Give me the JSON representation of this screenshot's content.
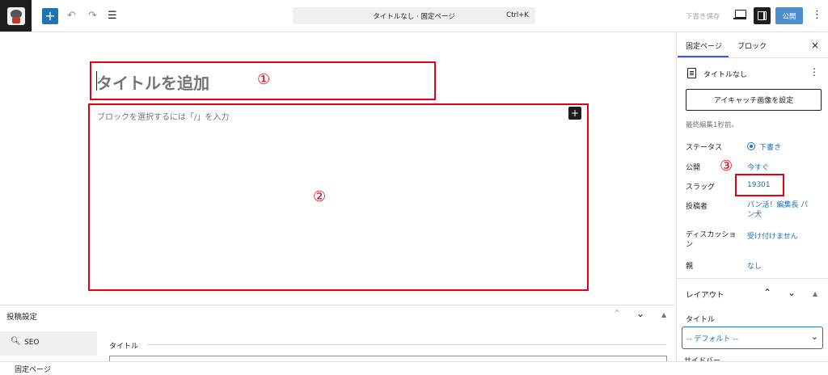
{
  "toolbar": {
    "command_title": "タイトルなし · 固定ページ",
    "command_shortcut": "Ctrl+K",
    "save_draft": "下書き保存",
    "publish": "公開",
    "add_block": "+",
    "undo_icon": "↶",
    "redo_icon": "↷",
    "list_view_icon": "☰",
    "options_icon": "⋮"
  },
  "editor": {
    "title_placeholder": "タイトルを追加",
    "block_placeholder": "ブロックを選択するには「/」を入力",
    "block_add": "+"
  },
  "annotations": {
    "marker_1": "①",
    "marker_2": "②",
    "marker_3": "③",
    "accent_color": "#e60012"
  },
  "meta_box": {
    "title": "投稿設定",
    "seo_tab": "SEO",
    "field_label": "タイトル"
  },
  "footer": {
    "breadcrumb": "固定ページ"
  },
  "sidebar": {
    "tabs": [
      "固定ページ",
      "ブロック"
    ],
    "close": "×",
    "doc_title": "タイトルなし",
    "featured_image_button": "アイキャッチ画像を設定",
    "last_edited": "最終編集1秒前。",
    "rows": [
      {
        "label": "ステータス",
        "value": "下書き"
      },
      {
        "label": "公開",
        "value": "今すぐ"
      },
      {
        "label": "スラッグ",
        "value": "19301"
      },
      {
        "label": "投稿者",
        "value": "パン活！編集長 パン犬"
      },
      {
        "label": "ディスカッション",
        "value": "受け付けません"
      },
      {
        "label": "親",
        "value": "なし"
      }
    ],
    "layout_section": "レイアウト",
    "template_label": "タイトル",
    "template_value": "-- デフォルト --",
    "cut_label": "サイドバー"
  },
  "colors": {
    "primary": "#2271b1",
    "publish_bg": "#4b8fd1",
    "dark": "#1e1e1e"
  }
}
